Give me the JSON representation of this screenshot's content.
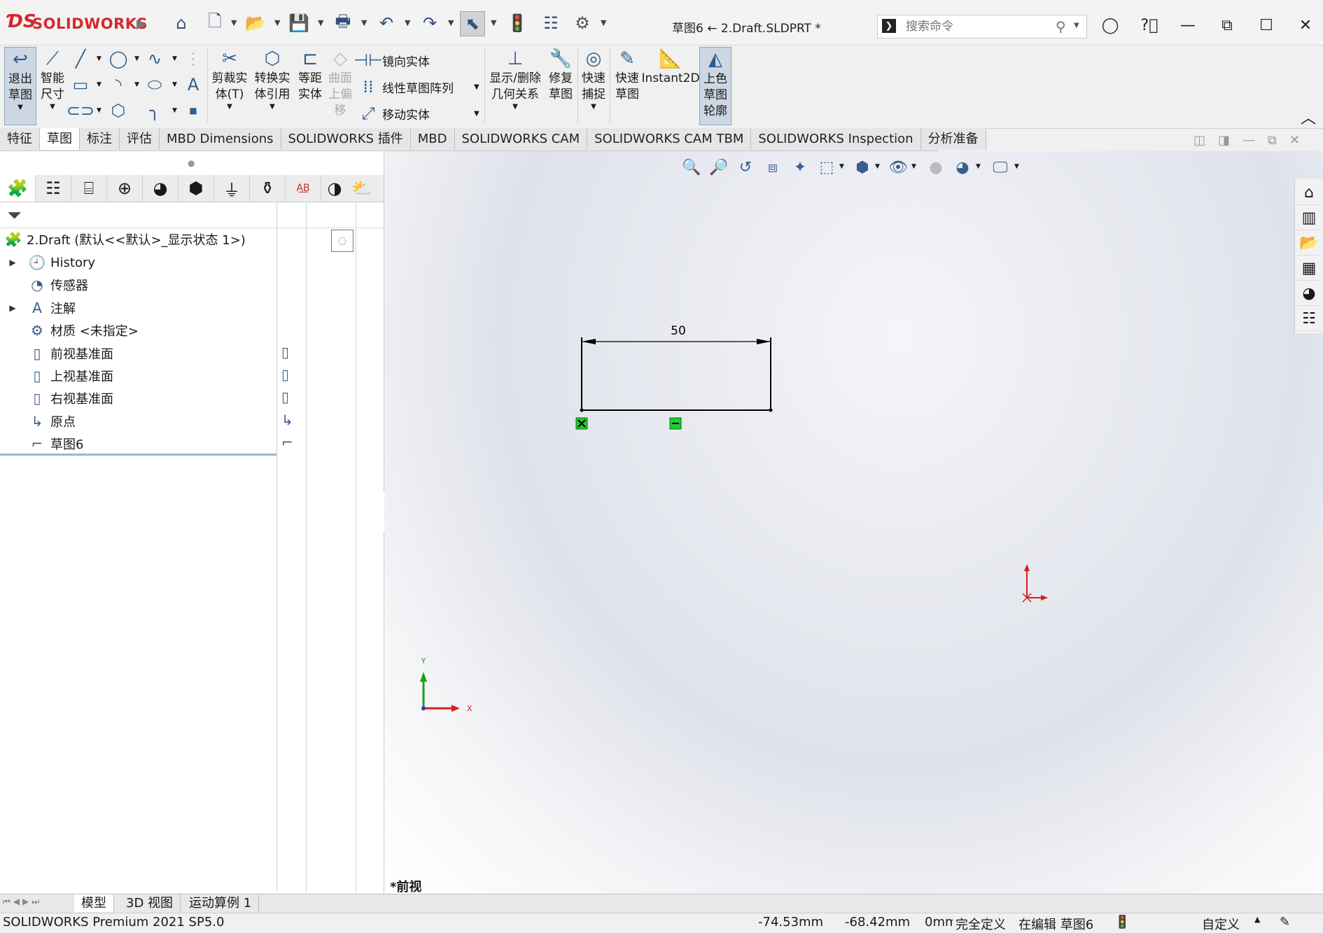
{
  "app": {
    "logo_text": "SOLIDWORKS",
    "document_title": "草图6 ← 2.Draft.SLDPRT *"
  },
  "search": {
    "placeholder": "搜索命令"
  },
  "colors": {
    "brand": "#d4282f",
    "accent": "#2d5e8e",
    "sketch_line": "#000000",
    "relation_box": "#22cc33",
    "axis_x": "#d42020",
    "axis_y": "#16a316"
  },
  "command_manager": {
    "exit_sketch": "退出\n草图",
    "smart_dimension": "智能\n尺寸",
    "trim_entities": "剪裁实\n体(T)",
    "convert_entities": "转换实\n体引用",
    "offset_entities": "等距\n实体",
    "offset_surface": "曲面\n上偏\n移",
    "mirror_entities": "镜向实体",
    "linear_pattern": "线性草图阵列",
    "move_entities": "移动实体",
    "display_relations": "显示/删除\n几何关系",
    "repair_sketch": "修复\n草图",
    "quick_snaps": "快速\n捕捉",
    "rapid_sketch": "快速\n草图",
    "instant2d": "Instant2D",
    "shaded_sketch": "上色\n草图\n轮廓"
  },
  "tabs": [
    "特征",
    "草图",
    "标注",
    "评估",
    "MBD Dimensions",
    "SOLIDWORKS 插件",
    "MBD",
    "SOLIDWORKS CAM",
    "SOLIDWORKS CAM TBM",
    "SOLIDWORKS Inspection",
    "分析准备"
  ],
  "active_tab": "草图",
  "tree": {
    "root": "2.Draft  (默认<<默认>_显示状态 1>)",
    "items": [
      {
        "label": "History",
        "icon": "history-icon",
        "expandable": true
      },
      {
        "label": "传感器",
        "icon": "sensor-icon",
        "expandable": false
      },
      {
        "label": "注解",
        "icon": "annotation-icon",
        "expandable": true
      },
      {
        "label": "材质 <未指定>",
        "icon": "material-icon",
        "expandable": false
      },
      {
        "label": "前视基准面",
        "icon": "plane-icon",
        "expandable": false
      },
      {
        "label": "上视基准面",
        "icon": "plane-icon",
        "expandable": false
      },
      {
        "label": "右视基准面",
        "icon": "plane-icon",
        "expandable": false
      },
      {
        "label": "原点",
        "icon": "origin-icon",
        "expandable": false
      },
      {
        "label": "草图6",
        "icon": "sketch-icon",
        "expandable": false
      }
    ]
  },
  "sketch": {
    "dimension_value": "50"
  },
  "triad": {
    "x_label": "X",
    "y_label": "Y"
  },
  "view_label": "*前视",
  "bottom_tabs": [
    "模型",
    "3D 视图",
    "运动算例 1"
  ],
  "status": {
    "product": "SOLIDWORKS Premium 2021 SP5.0",
    "x_coord": "-74.53mm",
    "y_coord": "-68.42mm",
    "z_coord": "0mm",
    "definition": "完全定义",
    "editing": "在编辑 草图6",
    "units": "自定义"
  }
}
